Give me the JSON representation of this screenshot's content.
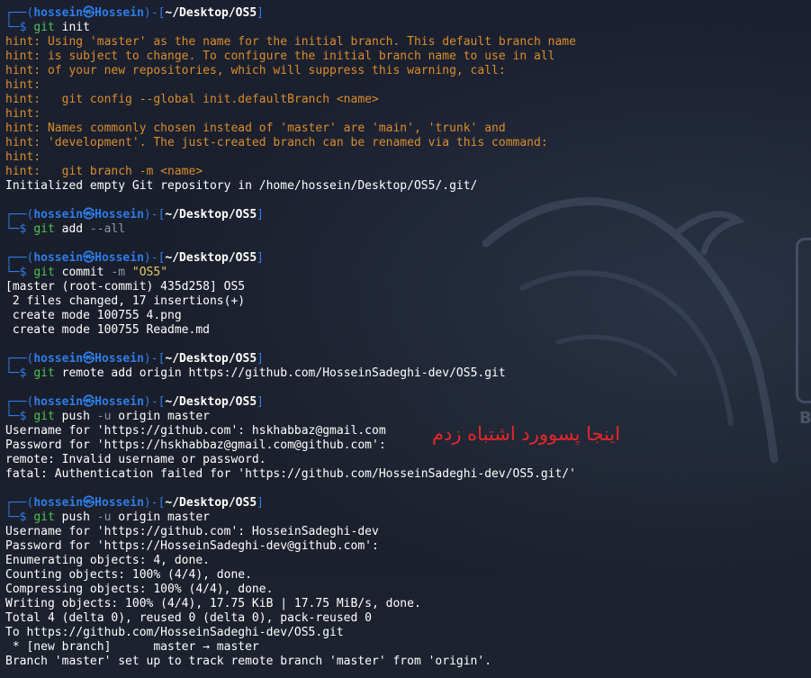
{
  "theme": {
    "background": "#1a1f2b",
    "prompt_blue": "#2e7de9",
    "git_green": "#4ec24e",
    "option_gray": "#8897a8",
    "string_yellow": "#e6c96e",
    "hint_orange": "#d98d2b",
    "annotation_red": "#e8262a"
  },
  "prompt": {
    "user": "hossein",
    "skull": "㉿",
    "host": "Hossein",
    "path": "~/Desktop/OS5"
  },
  "blocks": [
    {
      "cmd": "git",
      "args": [
        {
          "text": " init",
          "style": "cmd"
        }
      ],
      "output": [
        {
          "text": "hint: Using 'master' as the name for the initial branch. This default branch name",
          "style": "hint"
        },
        {
          "text": "hint: is subject to change. To configure the initial branch name to use in all",
          "style": "hint"
        },
        {
          "text": "hint: of your new repositories, which will suppress this warning, call:",
          "style": "hint"
        },
        {
          "text": "hint:",
          "style": "hint"
        },
        {
          "text": "hint:   git config --global init.defaultBranch <name>",
          "style": "hint"
        },
        {
          "text": "hint:",
          "style": "hint"
        },
        {
          "text": "hint: Names commonly chosen instead of 'master' are 'main', 'trunk' and",
          "style": "hint"
        },
        {
          "text": "hint: 'development'. The just-created branch can be renamed via this command:",
          "style": "hint"
        },
        {
          "text": "hint:",
          "style": "hint"
        },
        {
          "text": "hint:   git branch -m <name>",
          "style": "hint"
        },
        {
          "text": "Initialized empty Git repository in /home/hossein/Desktop/OS5/.git/",
          "style": "out"
        }
      ]
    },
    {
      "cmd": "git",
      "args": [
        {
          "text": " add ",
          "style": "cmd"
        },
        {
          "text": "--all",
          "style": "opt"
        }
      ],
      "output": []
    },
    {
      "cmd": "git",
      "args": [
        {
          "text": " commit ",
          "style": "cmd"
        },
        {
          "text": "-m",
          "style": "opt"
        },
        {
          "text": " ",
          "style": "cmd"
        },
        {
          "text": "\"OS5\"",
          "style": "str"
        }
      ],
      "output": [
        {
          "text": "[master (root-commit) 435d258] OS5",
          "style": "out"
        },
        {
          "text": " 2 files changed, 17 insertions(+)",
          "style": "out"
        },
        {
          "text": " create mode 100755 4.png",
          "style": "out"
        },
        {
          "text": " create mode 100755 Readme.md",
          "style": "out"
        }
      ]
    },
    {
      "cmd": "git",
      "args": [
        {
          "text": " remote add origin https://github.com/HosseinSadeghi-dev/OS5.git",
          "style": "cmd"
        }
      ],
      "output": []
    },
    {
      "cmd": "git",
      "args": [
        {
          "text": " push ",
          "style": "cmd"
        },
        {
          "text": "-u",
          "style": "opt"
        },
        {
          "text": " origin master",
          "style": "cmd"
        }
      ],
      "output": [
        {
          "text": "Username for 'https://github.com': hskhabbaz@gmail.com",
          "style": "out"
        },
        {
          "text": "Password for 'https://hskhabbaz@gmail.com@github.com':",
          "style": "out"
        },
        {
          "text": "remote: Invalid username or password.",
          "style": "out"
        },
        {
          "text": "fatal: Authentication failed for 'https://github.com/HosseinSadeghi-dev/OS5.git/'",
          "style": "out"
        }
      ]
    },
    {
      "cmd": "git",
      "args": [
        {
          "text": " push ",
          "style": "cmd"
        },
        {
          "text": "-u",
          "style": "opt"
        },
        {
          "text": " origin master",
          "style": "cmd"
        }
      ],
      "output": [
        {
          "text": "Username for 'https://github.com': HosseinSadeghi-dev",
          "style": "out"
        },
        {
          "text": "Password for 'https://HosseinSadeghi-dev@github.com':",
          "style": "out"
        },
        {
          "text": "Enumerating objects: 4, done.",
          "style": "out"
        },
        {
          "text": "Counting objects: 100% (4/4), done.",
          "style": "out"
        },
        {
          "text": "Compressing objects: 100% (4/4), done.",
          "style": "out"
        },
        {
          "text": "Writing objects: 100% (4/4), 17.75 KiB | 17.75 MiB/s, done.",
          "style": "out"
        },
        {
          "text": "Total 4 (delta 0), reused 0 (delta 0), pack-reused 0",
          "style": "out"
        },
        {
          "text": "To https://github.com/HosseinSadeghi-dev/OS5.git",
          "style": "out"
        },
        {
          "text": " * [new branch]      master → master",
          "style": "out"
        },
        {
          "text": "Branch 'master' set up to track remote branch 'master' from 'origin'.",
          "style": "out"
        }
      ]
    }
  ],
  "annotation": {
    "text": "اینجا پسوورد اشتباه زدم"
  },
  "background_logo": {
    "letter": "B"
  }
}
